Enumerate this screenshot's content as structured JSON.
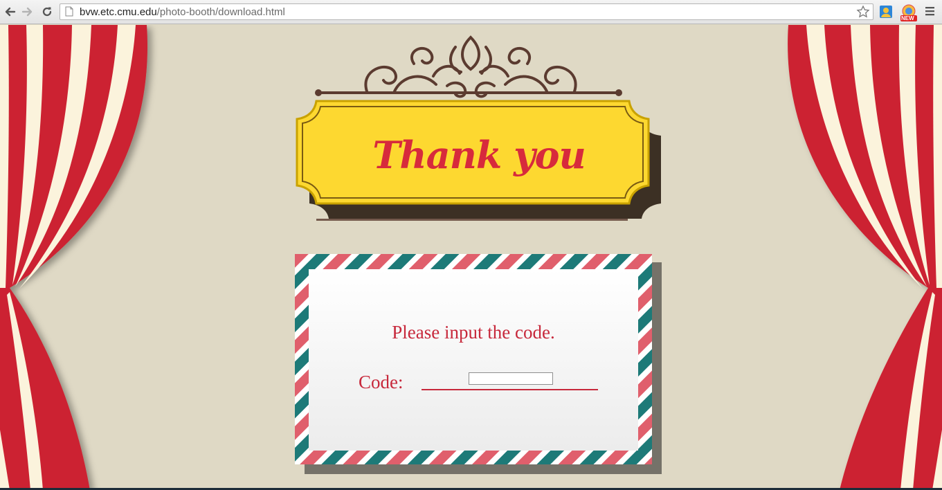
{
  "browser": {
    "url_host": "bvw.etc.cmu.edu",
    "url_path": "/photo-booth/download.html",
    "icons": [
      "back-arrow-icon",
      "forward-arrow-icon",
      "reload-icon",
      "page-icon",
      "star-icon",
      "contacts-extension-icon",
      "new-extension-icon",
      "menu-icon"
    ],
    "ext_badge": "NEW"
  },
  "sign": {
    "title": "Thank you"
  },
  "envelope": {
    "prompt": "Please input the code.",
    "code_label": "Code:",
    "code_value": "",
    "stripe_colors": [
      "#e05f6c",
      "#1d7a78"
    ]
  },
  "colors": {
    "curtain_red": "#cc2233",
    "curtain_cream": "#fbf3dc",
    "sign_yellow": "#fdd830",
    "text_red": "#c7283b"
  }
}
